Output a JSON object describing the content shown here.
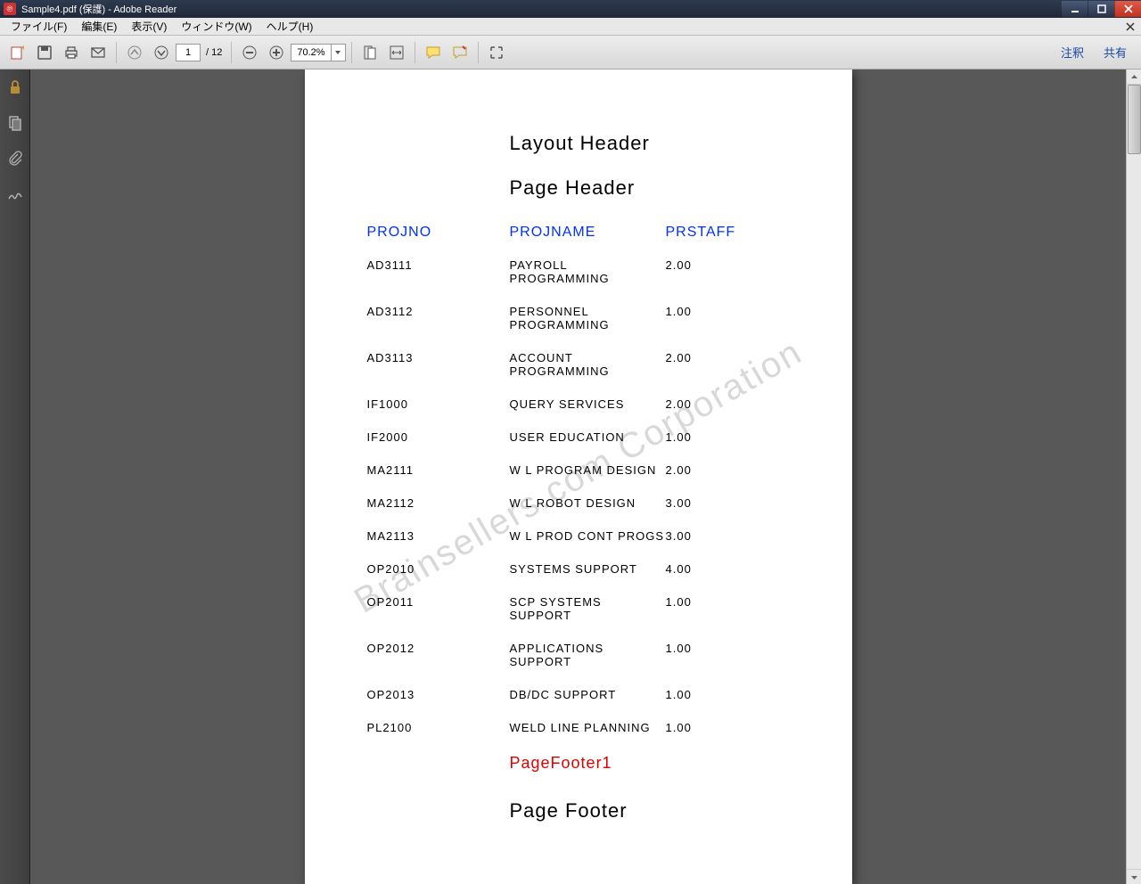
{
  "window": {
    "title": "Sample4.pdf (保護) - Adobe Reader"
  },
  "menu": {
    "file": "ファイル(F)",
    "edit": "編集(E)",
    "view": "表示(V)",
    "window": "ウィンドウ(W)",
    "help": "ヘルプ(H)"
  },
  "toolbar": {
    "page_current": "1",
    "page_total": "/ 12",
    "zoom": "70.2%",
    "annotate": "注釈",
    "share": "共有"
  },
  "document": {
    "watermark": "Brainsellers.com Corporation",
    "layout_header": "Layout Header",
    "page_header": "Page Header",
    "columns": {
      "c1": "PROJNO",
      "c2": "PROJNAME",
      "c3": "PRSTAFF"
    },
    "rows": [
      {
        "c1": "AD3111",
        "c2": "PAYROLL PROGRAMMING",
        "c3": "2.00"
      },
      {
        "c1": "AD3112",
        "c2": "PERSONNEL PROGRAMMING",
        "c3": "1.00"
      },
      {
        "c1": "AD3113",
        "c2": "ACCOUNT PROGRAMMING",
        "c3": "2.00"
      },
      {
        "c1": "IF1000",
        "c2": "QUERY SERVICES",
        "c3": "2.00"
      },
      {
        "c1": "IF2000",
        "c2": "USER EDUCATION",
        "c3": "1.00"
      },
      {
        "c1": "MA2111",
        "c2": "W L PROGRAM DESIGN",
        "c3": "2.00"
      },
      {
        "c1": "MA2112",
        "c2": "W L ROBOT DESIGN",
        "c3": "3.00"
      },
      {
        "c1": "MA2113",
        "c2": "W L PROD CONT PROGS",
        "c3": "3.00"
      },
      {
        "c1": "OP2010",
        "c2": "SYSTEMS SUPPORT",
        "c3": "4.00"
      },
      {
        "c1": "OP2011",
        "c2": "SCP SYSTEMS SUPPORT",
        "c3": "1.00"
      },
      {
        "c1": "OP2012",
        "c2": "APPLICATIONS SUPPORT",
        "c3": "1.00"
      },
      {
        "c1": "OP2013",
        "c2": "DB/DC SUPPORT",
        "c3": "1.00"
      },
      {
        "c1": "PL2100",
        "c2": "WELD LINE PLANNING",
        "c3": "1.00"
      }
    ],
    "page_footer1": "PageFooter1",
    "page_footer": "Page Footer"
  }
}
